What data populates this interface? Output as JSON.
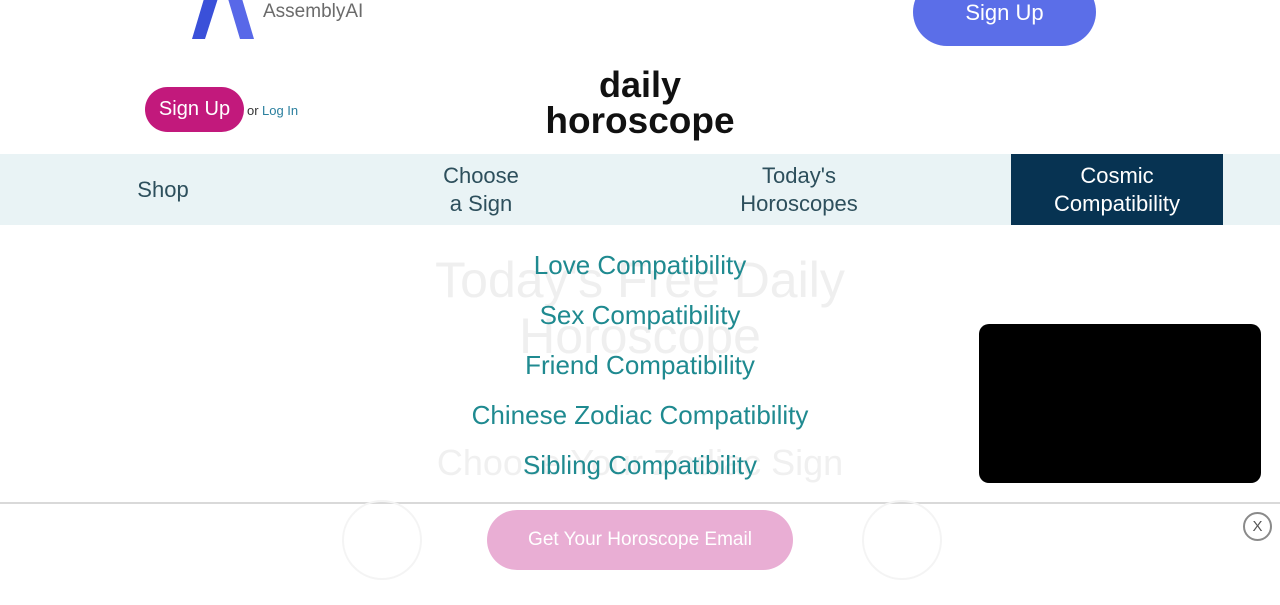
{
  "ad": {
    "brand": "AssemblyAI",
    "signup_label": "Sign Up"
  },
  "header": {
    "signup_label": "Sign Up",
    "or_text": "or",
    "login_label": "Log In",
    "logo_line1": "daily",
    "logo_line2": "horoscope"
  },
  "nav": {
    "shop": "Shop",
    "choose_line1": "Choose",
    "choose_line2": "a Sign",
    "today_line1": "Today's",
    "today_line2": "Horoscopes",
    "cosmic_line1": "Cosmic",
    "cosmic_line2": "Compatibility",
    "active": "Cosmic Compatibility"
  },
  "dropdown": {
    "items": [
      "Love Compatibility",
      "Sex Compatibility",
      "Friend Compatibility",
      "Chinese Zodiac Compatibility",
      "Sibling Compatibility"
    ]
  },
  "background": {
    "title": "Today's Free Daily Horoscope",
    "subtitle": "Choose Your Zodiac Sign"
  },
  "bottom": {
    "cta_label": "Get Your Horoscope Email",
    "close_label": "X"
  },
  "colors": {
    "ad_signup": "#5b6ee8",
    "site_signup": "#c2197c",
    "nav_active": "#073352",
    "dropdown_text": "#1f8a90",
    "cta": "#e9aed4"
  },
  "icons": {
    "ad_logo": "assemblyai-logo-icon",
    "close": "close-icon"
  }
}
